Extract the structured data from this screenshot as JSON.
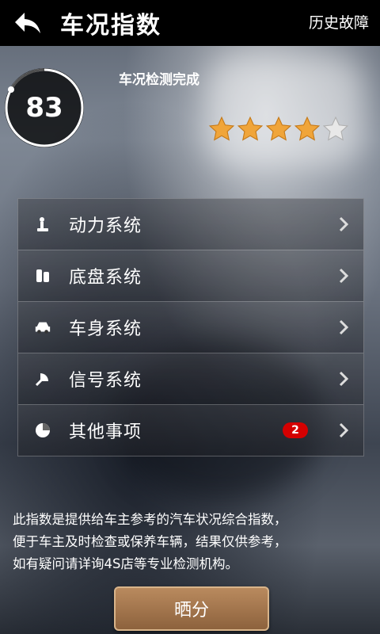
{
  "header": {
    "title": "车况指数",
    "history_label": "历史故障"
  },
  "score": {
    "value": "83",
    "status": "车况检测完成",
    "stars_filled": 4,
    "stars_total": 5,
    "ring_progress": 0.83
  },
  "menu": [
    {
      "label": "动力系统",
      "icon": "engine-icon"
    },
    {
      "label": "底盘系统",
      "icon": "chassis-icon"
    },
    {
      "label": "车身系统",
      "icon": "car-body-icon"
    },
    {
      "label": "信号系统",
      "icon": "signal-icon"
    },
    {
      "label": "其他事项",
      "icon": "pie-icon",
      "badge": "2"
    }
  ],
  "note": [
    "此指数是提供给车主参考的汽车状况综合指数，",
    "便于车主及时检查或保养车辆，结果仅供参考，",
    "如有疑问请详询4S店等专业检测机构。"
  ],
  "share_label": "晒分",
  "colors": {
    "star_filled": "#f0a53a",
    "star_empty": "#e8e8e8",
    "badge": "#d40000",
    "button": "#a3744b"
  }
}
